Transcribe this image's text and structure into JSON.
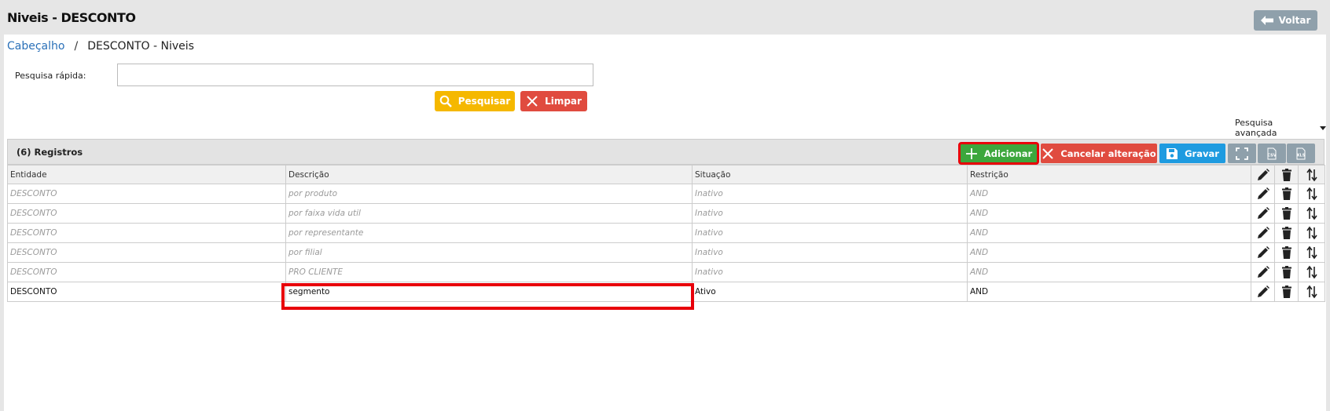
{
  "header": {
    "title": "Niveis - DESCONTO",
    "back_label": "Voltar"
  },
  "breadcrumb": {
    "link": "Cabeçalho",
    "separator": "/",
    "current": "DESCONTO - Niveis"
  },
  "search": {
    "label": "Pesquisa rápida:",
    "value": "",
    "search_button": "Pesquisar",
    "clear_button": "Limpar",
    "advanced_label": "Pesquisa avançada"
  },
  "grid": {
    "records_label": "(6) Registros",
    "toolbar": {
      "add": "Adicionar",
      "cancel": "Cancelar alteração",
      "save": "Gravar"
    },
    "columns": [
      "Entidade",
      "Descrição",
      "Situação",
      "Restrição"
    ],
    "rows": [
      {
        "entidade": "DESCONTO",
        "descricao": "por produto",
        "situacao": "Inativo",
        "restricao": "AND"
      },
      {
        "entidade": "DESCONTO",
        "descricao": "por faixa vida util",
        "situacao": "Inativo",
        "restricao": "AND"
      },
      {
        "entidade": "DESCONTO",
        "descricao": "por representante",
        "situacao": "Inativo",
        "restricao": "AND"
      },
      {
        "entidade": "DESCONTO",
        "descricao": "por filial",
        "situacao": "Inativo",
        "restricao": "AND"
      },
      {
        "entidade": "DESCONTO",
        "descricao": "PRO CLIENTE",
        "situacao": "Inativo",
        "restricao": "AND"
      },
      {
        "entidade": "DESCONTO",
        "descricao": "segmento",
        "situacao": "Ativo",
        "restricao": "AND"
      }
    ]
  },
  "colors": {
    "accent_blue": "#1e9be0",
    "add_green": "#3da73d",
    "danger_red": "#e04b3f",
    "search_yellow": "#f5b800",
    "highlight_red": "#e8000a"
  }
}
